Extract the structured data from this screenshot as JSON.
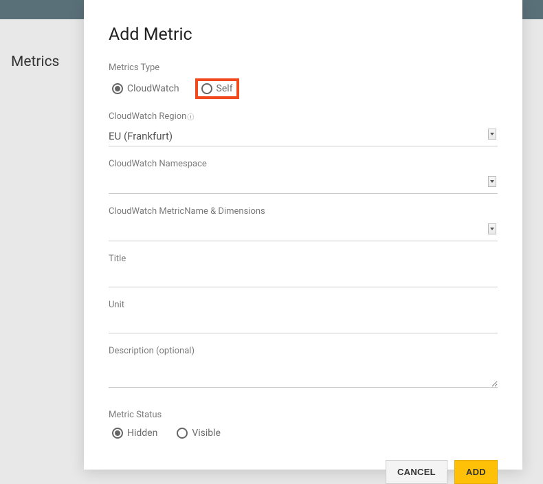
{
  "page": {
    "title": "Metrics"
  },
  "modal": {
    "title": "Add Metric",
    "metricsType": {
      "label": "Metrics Type",
      "options": {
        "cloudwatch": "CloudWatch",
        "self": "Self"
      }
    },
    "region": {
      "label": "CloudWatch Region",
      "value": "EU (Frankfurt)"
    },
    "namespace": {
      "label": "CloudWatch Namespace",
      "value": ""
    },
    "metric": {
      "label": "CloudWatch MetricName & Dimensions",
      "value": ""
    },
    "titleField": {
      "label": "Title",
      "value": ""
    },
    "unit": {
      "label": "Unit",
      "value": ""
    },
    "description": {
      "label": "Description (optional)",
      "value": ""
    },
    "metricStatus": {
      "label": "Metric Status",
      "options": {
        "hidden": "Hidden",
        "visible": "Visible"
      }
    },
    "buttons": {
      "cancel": "CANCEL",
      "add": "ADD"
    }
  }
}
